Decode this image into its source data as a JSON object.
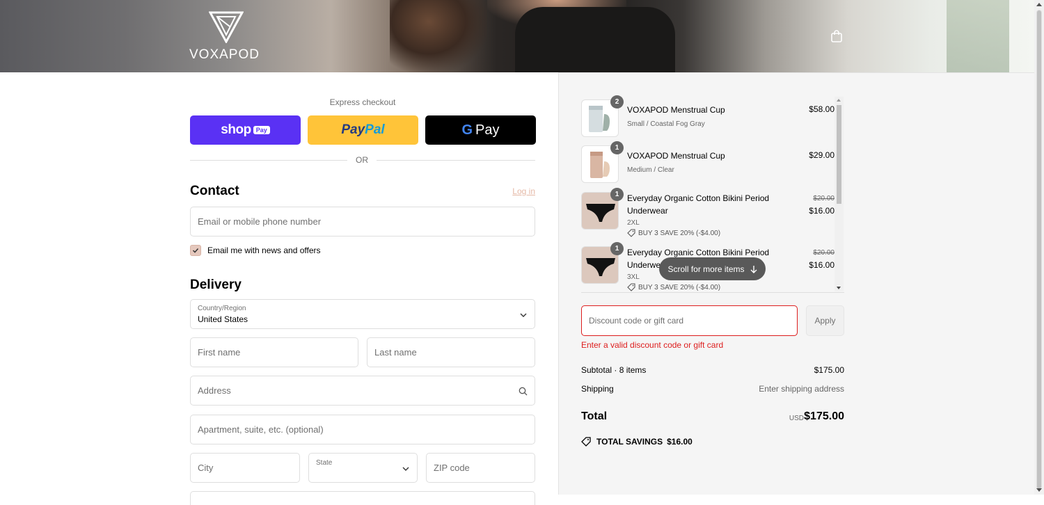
{
  "brand": {
    "name": "VOXAPOD"
  },
  "colors": {
    "shop_pay": "#5a31f4",
    "paypal": "#ffc439",
    "gpay": "#000000",
    "accent": "#e5b9a6",
    "error": "#dd1d1d"
  },
  "express": {
    "label": "Express checkout",
    "shop_text": "shop",
    "shop_pay": "Pay",
    "paypal_1": "Pay",
    "paypal_2": "Pal",
    "gpay_g": "G",
    "gpay_text": "Pay",
    "or": "OR"
  },
  "contact": {
    "title": "Contact",
    "login": "Log in",
    "email_placeholder": "Email or mobile phone number",
    "newsletter_label": "Email me with news and offers",
    "newsletter_checked": true
  },
  "delivery": {
    "title": "Delivery",
    "country_label": "Country/Region",
    "country_value": "United States",
    "first_name": "First name",
    "last_name": "Last name",
    "address": "Address",
    "apartment": "Apartment, suite, etc. (optional)",
    "city": "City",
    "state": "State",
    "zip": "ZIP code"
  },
  "cart": {
    "items": [
      {
        "qty": "2",
        "name": "VOXAPOD Menstrual Cup",
        "variant": "Small / Coastal Fog Gray",
        "price": "$58.00",
        "old_price": "",
        "discount": ""
      },
      {
        "qty": "1",
        "name": "VOXAPOD Menstrual Cup",
        "variant": "Medium / Clear",
        "price": "$29.00",
        "old_price": "",
        "discount": ""
      },
      {
        "qty": "1",
        "name": "Everyday Organic Cotton Bikini Period Underwear",
        "variant": "2XL",
        "price": "$16.00",
        "old_price": "$20.00",
        "discount": "BUY 3 SAVE 20% (-$4.00)"
      },
      {
        "qty": "1",
        "name": "Everyday Organic Cotton Bikini Period Underwear",
        "variant": "3XL",
        "price": "$16.00",
        "old_price": "$20.00",
        "discount": "BUY 3 SAVE 20% (-$4.00)"
      }
    ],
    "scroll_hint": "Scroll for more items",
    "discount_placeholder": "Discount code or gift card",
    "apply": "Apply",
    "error": "Enter a valid discount code or gift card",
    "subtotal_label": "Subtotal · 8 items",
    "subtotal_value": "$175.00",
    "shipping_label": "Shipping",
    "shipping_value": "Enter shipping address",
    "total_label": "Total",
    "total_currency": "USD",
    "total_value": "$175.00",
    "savings_label": "TOTAL SAVINGS",
    "savings_value": "$16.00"
  }
}
